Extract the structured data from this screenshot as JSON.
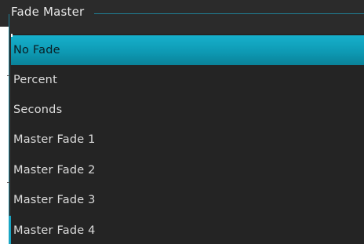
{
  "group": {
    "title": "Fade Master"
  },
  "dropdown": {
    "selected": "No Fade",
    "options": [
      {
        "label": "No Fade",
        "selected": true
      },
      {
        "label": "Percent",
        "selected": false
      },
      {
        "label": "Seconds",
        "selected": false
      },
      {
        "label": "Master Fade 1",
        "selected": false
      },
      {
        "label": "Master Fade 2",
        "selected": false
      },
      {
        "label": "Master Fade 3",
        "selected": false
      },
      {
        "label": "Master Fade 4",
        "selected": false
      }
    ]
  },
  "colors": {
    "accent": "#16b0cc",
    "panel": "#242424",
    "text": "#dcdcdc"
  }
}
